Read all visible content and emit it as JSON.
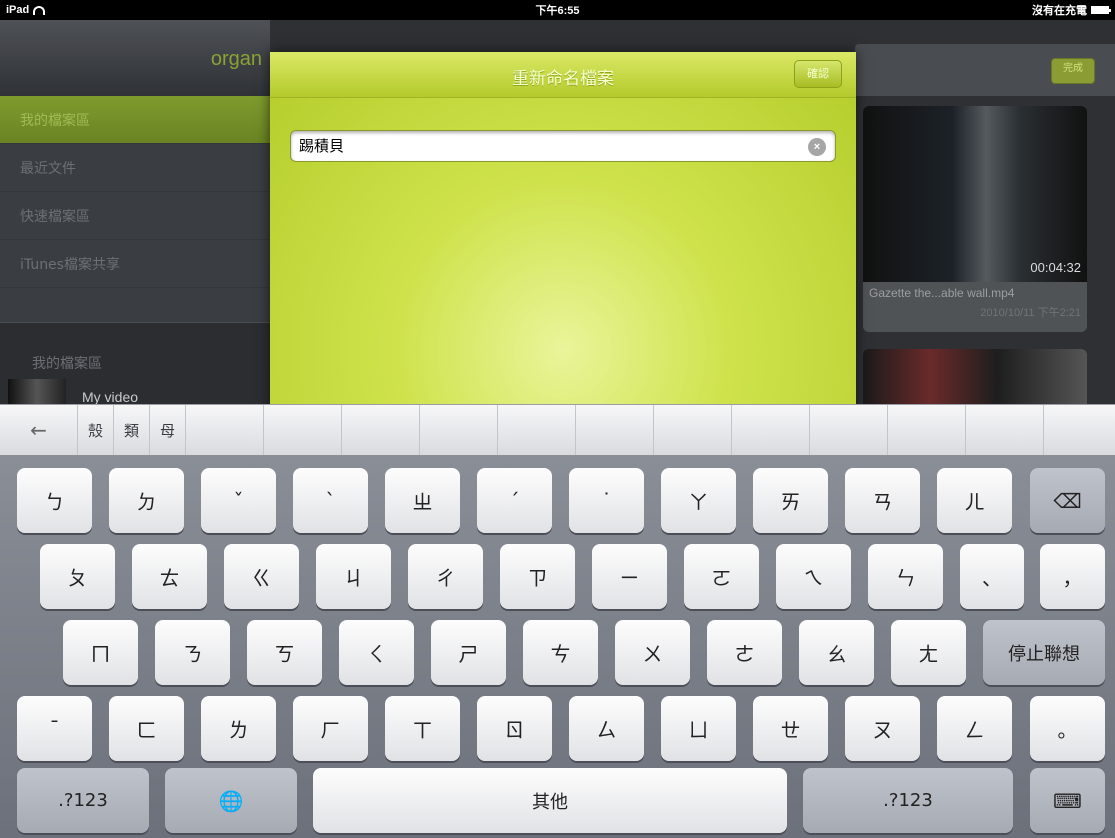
{
  "status_bar": {
    "device": "iPad",
    "time": "下午6:55",
    "charging": "沒有在充電"
  },
  "sidebar": {
    "title": "organ",
    "items": [
      {
        "label": "我的檔案區",
        "active": true
      },
      {
        "label": "最近文件"
      },
      {
        "label": "快速檔案區"
      },
      {
        "label": "iTunes檔案共享"
      }
    ],
    "section_title": "我的檔案區",
    "video_label": "My video"
  },
  "content": {
    "done_label": "完成",
    "video": {
      "duration": "00:04:32",
      "name": "Gazette the...able wall.mp4",
      "date": "2010/10/11 下午2:21"
    }
  },
  "sheet": {
    "title": "重新命名檔案",
    "button_label": "確認",
    "field_value": "踢積貝",
    "clear_icon": "clear-icon"
  },
  "candidates": {
    "arrow": "←",
    "items": [
      "殼",
      "類",
      "母"
    ]
  },
  "keyboard": {
    "row1": [
      "ㄅ",
      "ㄉ",
      "ˇ",
      "ˋ",
      "ㄓ",
      "ˊ",
      "˙",
      "ㄚ",
      "ㄞ",
      "ㄢ",
      "ㄦ",
      "⌫"
    ],
    "row2": [
      "ㄆ",
      "ㄊ",
      "ㄍ",
      "ㄐ",
      "ㄔ",
      "ㄗ",
      "ㄧ",
      "ㄛ",
      "ㄟ",
      "ㄣ",
      "、",
      "，"
    ],
    "row3": [
      "ㄇ",
      "ㄋ",
      "ㄎ",
      "ㄑ",
      "ㄕ",
      "ㄘ",
      "ㄨ",
      "ㄜ",
      "ㄠ",
      "ㄤ",
      "停止聯想"
    ],
    "row4": [
      "ˉ",
      "ㄈ",
      "ㄌ",
      "ㄏ",
      "ㄒ",
      "ㄖ",
      "ㄙ",
      "ㄩ",
      "ㄝ",
      "ㄡ",
      "ㄥ",
      "。"
    ],
    "row5": [
      ".?123",
      "🌐",
      "其他",
      ".?123",
      "⌨"
    ]
  }
}
